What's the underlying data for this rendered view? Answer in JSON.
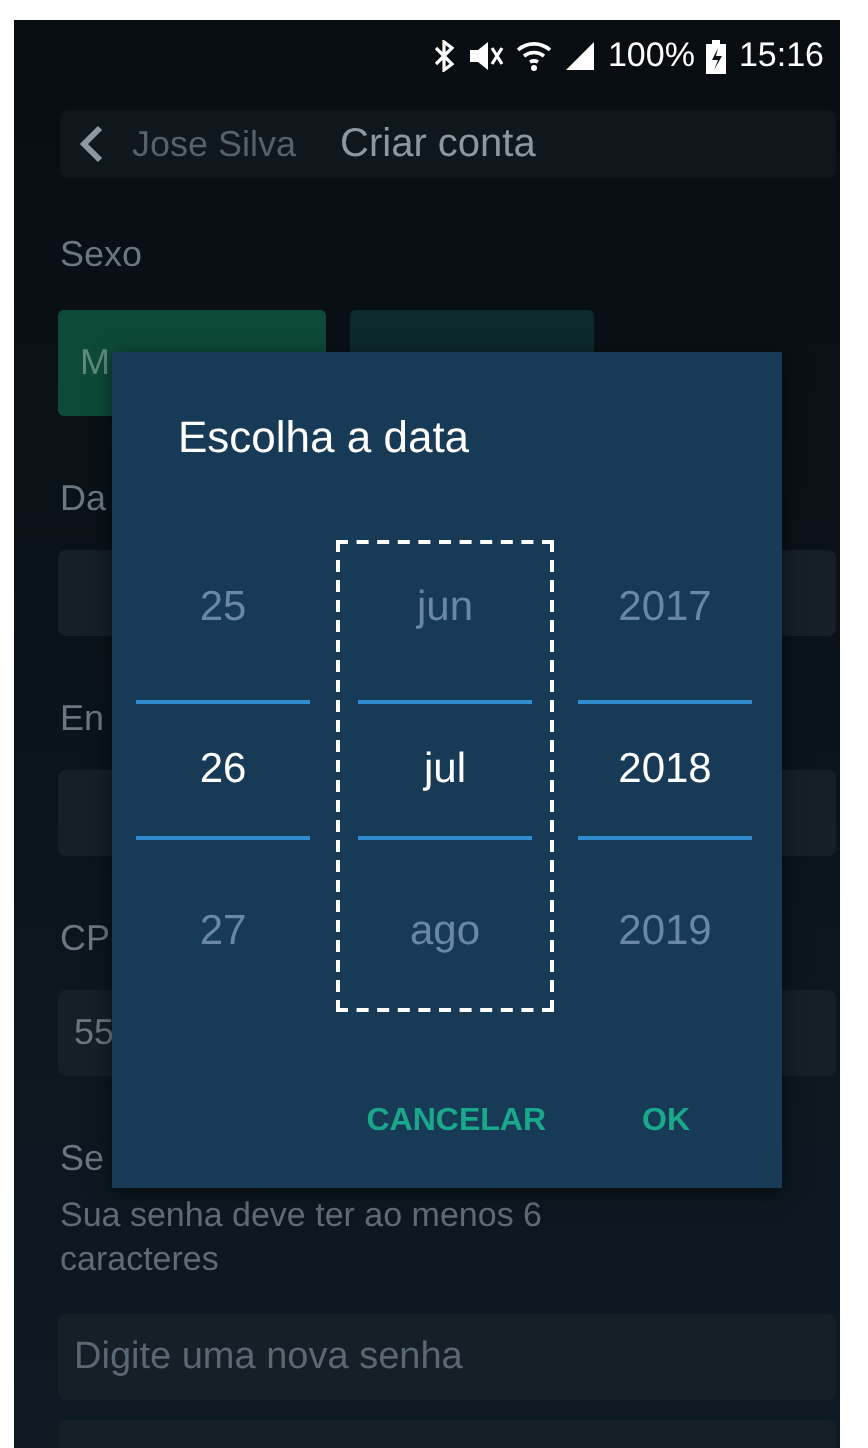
{
  "status_bar": {
    "battery": "100%",
    "time": "15:16"
  },
  "header": {
    "name_value": "Jose Silva",
    "title": "Criar conta"
  },
  "gender": {
    "label": "Sexo",
    "options": [
      {
        "label": "M",
        "selected": true
      },
      {
        "selected": false
      }
    ]
  },
  "fields": [
    {
      "label": "Da"
    },
    {
      "label": "En"
    },
    {
      "label": "CP",
      "value": "55"
    }
  ],
  "password": {
    "label": "Se",
    "hint": "Sua senha deve ter ao menos 6 caracteres",
    "placeholder": "Digite uma nova senha"
  },
  "dialog": {
    "title": "Escolha a data",
    "columns": [
      {
        "focused": false,
        "values": [
          {
            "text": "25",
            "selected": false
          },
          {
            "text": "26",
            "selected": true
          },
          {
            "text": "27",
            "selected": false
          }
        ]
      },
      {
        "focused": true,
        "values": [
          {
            "text": "jun",
            "selected": false
          },
          {
            "text": "jul",
            "selected": true
          },
          {
            "text": "ago",
            "selected": false
          }
        ]
      },
      {
        "focused": false,
        "values": [
          {
            "text": "2017",
            "selected": false
          },
          {
            "text": "2018",
            "selected": true
          },
          {
            "text": "2019",
            "selected": false
          }
        ]
      }
    ],
    "buttons": [
      "CANCELAR",
      "OK"
    ]
  }
}
